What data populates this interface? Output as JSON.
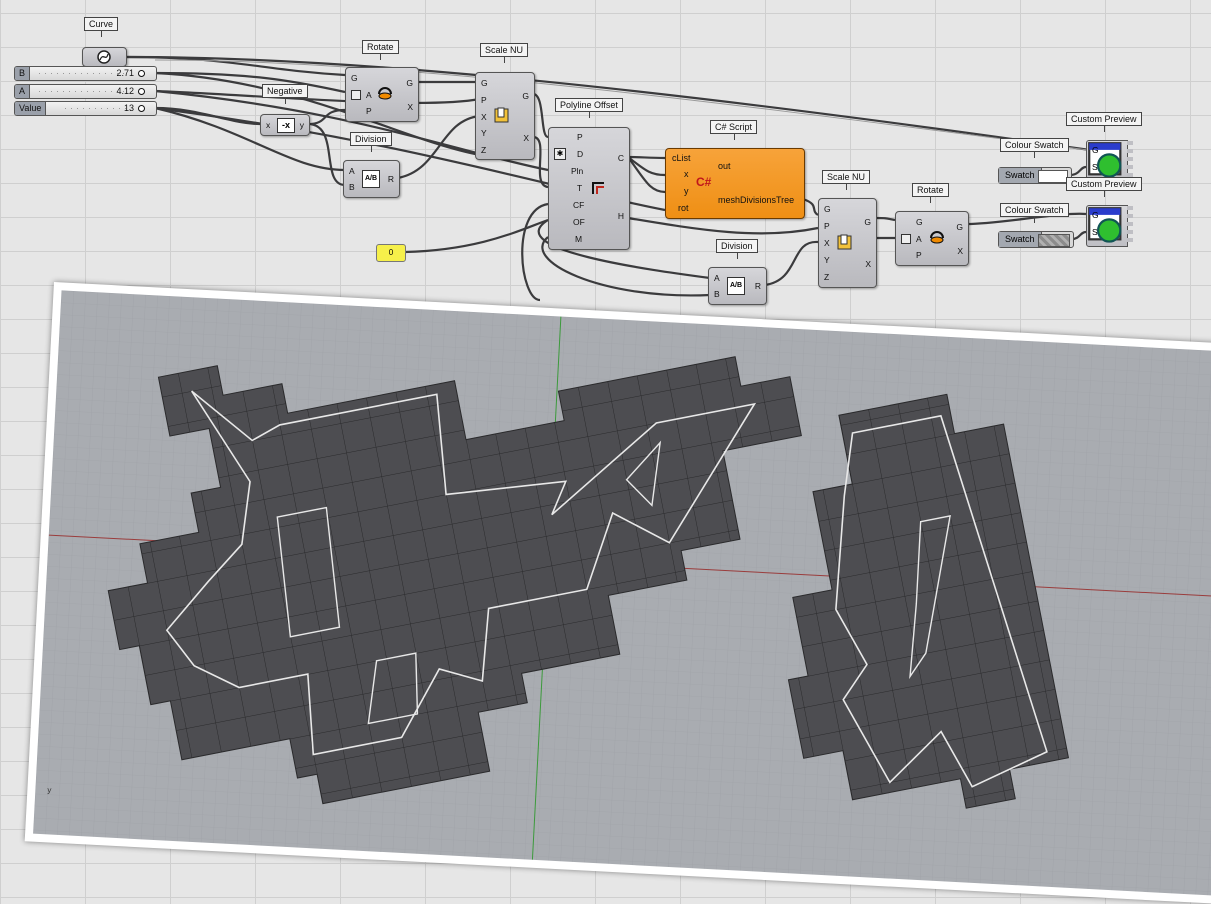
{
  "components": {
    "curve": {
      "label": "Curve"
    },
    "slider_b": {
      "name": "B",
      "value": "2.71"
    },
    "slider_a": {
      "name": "A",
      "value": "4.12"
    },
    "slider_value": {
      "name": "Value",
      "value": "13"
    },
    "rotate1": {
      "label": "Rotate",
      "inputs": [
        "G",
        "A",
        "P"
      ],
      "outputs": [
        "G",
        "X"
      ]
    },
    "negative": {
      "label": "Negative",
      "input": "x",
      "output": "y",
      "glyph": "-x"
    },
    "division1": {
      "label": "Division",
      "inputs": [
        "A",
        "B"
      ],
      "output": "R",
      "glyph": "A/B"
    },
    "scale_nu1": {
      "label": "Scale NU",
      "inputs": [
        "G",
        "P",
        "X",
        "Y",
        "Z"
      ],
      "outputs": [
        "G",
        "X"
      ]
    },
    "polyline_offset": {
      "label": "Polyline Offset",
      "inputs": [
        "P",
        "D",
        "Pln",
        "T",
        "CF",
        "OF",
        "M"
      ],
      "outputs": [
        "C",
        "H"
      ]
    },
    "csharp": {
      "label": "C# Script",
      "inputs": [
        "cList",
        "x",
        "y",
        "rot"
      ],
      "outputs": [
        "out",
        "meshDivisionsTree"
      ],
      "glyph": "C#"
    },
    "panel_zero": {
      "value": "0"
    },
    "division2": {
      "label": "Division",
      "inputs": [
        "A",
        "B"
      ],
      "output": "R",
      "glyph": "A/B"
    },
    "scale_nu2": {
      "label": "Scale NU",
      "inputs": [
        "G",
        "P",
        "X",
        "Y",
        "Z"
      ],
      "outputs": [
        "G",
        "X"
      ]
    },
    "rotate2": {
      "label": "Rotate",
      "inputs": [
        "G",
        "A",
        "P"
      ],
      "outputs": [
        "G",
        "X"
      ]
    },
    "colour_swatch1": {
      "label": "Colour Swatch",
      "name": "Swatch",
      "color": "#ffffff"
    },
    "colour_swatch2": {
      "label": "Colour Swatch",
      "name": "Swatch",
      "color": "#9a9a9a"
    },
    "custom_preview1": {
      "label": "Custom Preview",
      "inputs": [
        "G",
        "S"
      ]
    },
    "custom_preview2": {
      "label": "Custom Preview",
      "inputs": [
        "G",
        "S"
      ]
    }
  },
  "viewport": {
    "axis_label": "y",
    "colors": {
      "background": "#a9acb1",
      "mesh_fill": "#4d4d51",
      "mesh_line": "#2a2a2c",
      "curve": "#e8e8e8",
      "axis_green": "#3c9a3c",
      "axis_red": "#9a3c3c"
    }
  }
}
